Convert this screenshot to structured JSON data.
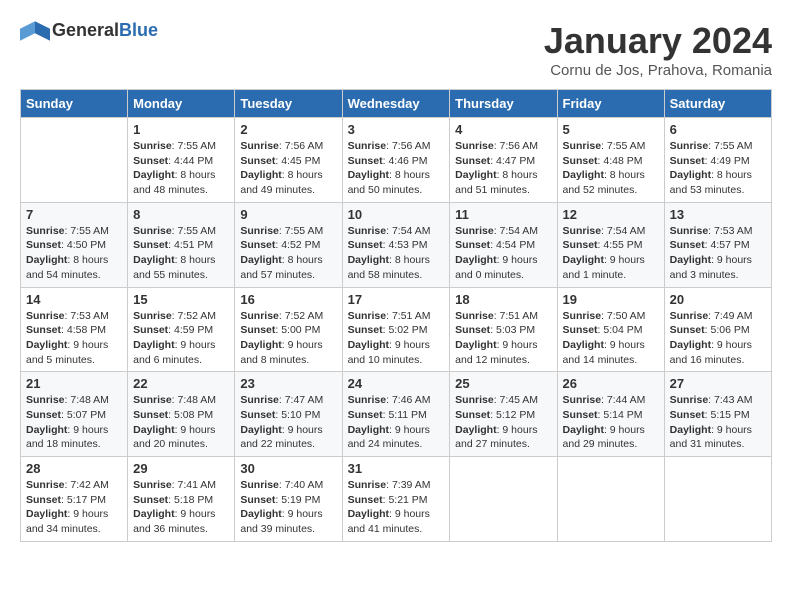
{
  "header": {
    "logo_general": "General",
    "logo_blue": "Blue",
    "title": "January 2024",
    "subtitle": "Cornu de Jos, Prahova, Romania"
  },
  "days_of_week": [
    "Sunday",
    "Monday",
    "Tuesday",
    "Wednesday",
    "Thursday",
    "Friday",
    "Saturday"
  ],
  "weeks": [
    [
      {
        "day": "",
        "info": ""
      },
      {
        "day": "1",
        "info": "Sunrise: 7:55 AM\nSunset: 4:44 PM\nDaylight: 8 hours\nand 48 minutes."
      },
      {
        "day": "2",
        "info": "Sunrise: 7:56 AM\nSunset: 4:45 PM\nDaylight: 8 hours\nand 49 minutes."
      },
      {
        "day": "3",
        "info": "Sunrise: 7:56 AM\nSunset: 4:46 PM\nDaylight: 8 hours\nand 50 minutes."
      },
      {
        "day": "4",
        "info": "Sunrise: 7:56 AM\nSunset: 4:47 PM\nDaylight: 8 hours\nand 51 minutes."
      },
      {
        "day": "5",
        "info": "Sunrise: 7:55 AM\nSunset: 4:48 PM\nDaylight: 8 hours\nand 52 minutes."
      },
      {
        "day": "6",
        "info": "Sunrise: 7:55 AM\nSunset: 4:49 PM\nDaylight: 8 hours\nand 53 minutes."
      }
    ],
    [
      {
        "day": "7",
        "info": "Sunrise: 7:55 AM\nSunset: 4:50 PM\nDaylight: 8 hours\nand 54 minutes."
      },
      {
        "day": "8",
        "info": "Sunrise: 7:55 AM\nSunset: 4:51 PM\nDaylight: 8 hours\nand 55 minutes."
      },
      {
        "day": "9",
        "info": "Sunrise: 7:55 AM\nSunset: 4:52 PM\nDaylight: 8 hours\nand 57 minutes."
      },
      {
        "day": "10",
        "info": "Sunrise: 7:54 AM\nSunset: 4:53 PM\nDaylight: 8 hours\nand 58 minutes."
      },
      {
        "day": "11",
        "info": "Sunrise: 7:54 AM\nSunset: 4:54 PM\nDaylight: 9 hours\nand 0 minutes."
      },
      {
        "day": "12",
        "info": "Sunrise: 7:54 AM\nSunset: 4:55 PM\nDaylight: 9 hours\nand 1 minute."
      },
      {
        "day": "13",
        "info": "Sunrise: 7:53 AM\nSunset: 4:57 PM\nDaylight: 9 hours\nand 3 minutes."
      }
    ],
    [
      {
        "day": "14",
        "info": "Sunrise: 7:53 AM\nSunset: 4:58 PM\nDaylight: 9 hours\nand 5 minutes."
      },
      {
        "day": "15",
        "info": "Sunrise: 7:52 AM\nSunset: 4:59 PM\nDaylight: 9 hours\nand 6 minutes."
      },
      {
        "day": "16",
        "info": "Sunrise: 7:52 AM\nSunset: 5:00 PM\nDaylight: 9 hours\nand 8 minutes."
      },
      {
        "day": "17",
        "info": "Sunrise: 7:51 AM\nSunset: 5:02 PM\nDaylight: 9 hours\nand 10 minutes."
      },
      {
        "day": "18",
        "info": "Sunrise: 7:51 AM\nSunset: 5:03 PM\nDaylight: 9 hours\nand 12 minutes."
      },
      {
        "day": "19",
        "info": "Sunrise: 7:50 AM\nSunset: 5:04 PM\nDaylight: 9 hours\nand 14 minutes."
      },
      {
        "day": "20",
        "info": "Sunrise: 7:49 AM\nSunset: 5:06 PM\nDaylight: 9 hours\nand 16 minutes."
      }
    ],
    [
      {
        "day": "21",
        "info": "Sunrise: 7:48 AM\nSunset: 5:07 PM\nDaylight: 9 hours\nand 18 minutes."
      },
      {
        "day": "22",
        "info": "Sunrise: 7:48 AM\nSunset: 5:08 PM\nDaylight: 9 hours\nand 20 minutes."
      },
      {
        "day": "23",
        "info": "Sunrise: 7:47 AM\nSunset: 5:10 PM\nDaylight: 9 hours\nand 22 minutes."
      },
      {
        "day": "24",
        "info": "Sunrise: 7:46 AM\nSunset: 5:11 PM\nDaylight: 9 hours\nand 24 minutes."
      },
      {
        "day": "25",
        "info": "Sunrise: 7:45 AM\nSunset: 5:12 PM\nDaylight: 9 hours\nand 27 minutes."
      },
      {
        "day": "26",
        "info": "Sunrise: 7:44 AM\nSunset: 5:14 PM\nDaylight: 9 hours\nand 29 minutes."
      },
      {
        "day": "27",
        "info": "Sunrise: 7:43 AM\nSunset: 5:15 PM\nDaylight: 9 hours\nand 31 minutes."
      }
    ],
    [
      {
        "day": "28",
        "info": "Sunrise: 7:42 AM\nSunset: 5:17 PM\nDaylight: 9 hours\nand 34 minutes."
      },
      {
        "day": "29",
        "info": "Sunrise: 7:41 AM\nSunset: 5:18 PM\nDaylight: 9 hours\nand 36 minutes."
      },
      {
        "day": "30",
        "info": "Sunrise: 7:40 AM\nSunset: 5:19 PM\nDaylight: 9 hours\nand 39 minutes."
      },
      {
        "day": "31",
        "info": "Sunrise: 7:39 AM\nSunset: 5:21 PM\nDaylight: 9 hours\nand 41 minutes."
      },
      {
        "day": "",
        "info": ""
      },
      {
        "day": "",
        "info": ""
      },
      {
        "day": "",
        "info": ""
      }
    ]
  ]
}
